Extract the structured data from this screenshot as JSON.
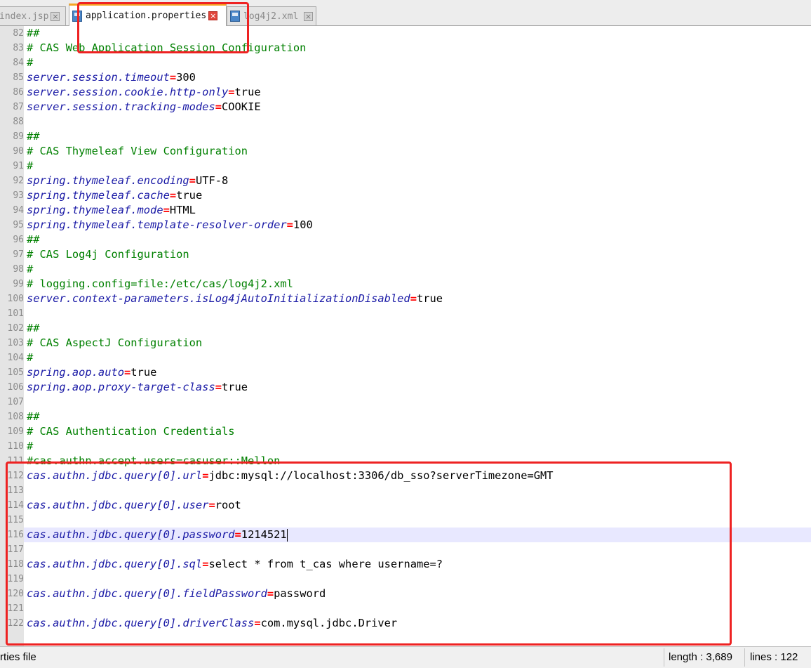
{
  "tabs": [
    {
      "label": "index.jsp",
      "active": false
    },
    {
      "label": "application.properties",
      "active": true
    },
    {
      "label": "log4j2.xml",
      "active": false
    }
  ],
  "lines": [
    {
      "num": "82",
      "type": "comment",
      "text": "##"
    },
    {
      "num": "83",
      "type": "comment",
      "text": "# CAS Web Application Session Configuration"
    },
    {
      "num": "84",
      "type": "comment",
      "text": "#"
    },
    {
      "num": "85",
      "type": "prop",
      "key": "server.session.timeout",
      "eq": "=",
      "value": "300"
    },
    {
      "num": "86",
      "type": "prop",
      "key": "server.session.cookie.http-only",
      "eq": "=",
      "value": "true"
    },
    {
      "num": "87",
      "type": "prop",
      "key": "server.session.tracking-modes",
      "eq": "=",
      "value": "COOKIE"
    },
    {
      "num": "88",
      "type": "blank"
    },
    {
      "num": "89",
      "type": "comment",
      "text": "##"
    },
    {
      "num": "90",
      "type": "comment",
      "text": "# CAS Thymeleaf View Configuration"
    },
    {
      "num": "91",
      "type": "comment",
      "text": "#"
    },
    {
      "num": "92",
      "type": "prop",
      "key": "spring.thymeleaf.encoding",
      "eq": "=",
      "value": "UTF-8"
    },
    {
      "num": "93",
      "type": "prop",
      "key": "spring.thymeleaf.cache",
      "eq": "=",
      "value": "true"
    },
    {
      "num": "94",
      "type": "prop",
      "key": "spring.thymeleaf.mode",
      "eq": "=",
      "value": "HTML"
    },
    {
      "num": "95",
      "type": "prop",
      "key": "spring.thymeleaf.template-resolver-order",
      "eq": "=",
      "value": "100"
    },
    {
      "num": "96",
      "type": "comment",
      "text": "##"
    },
    {
      "num": "97",
      "type": "comment",
      "text": "# CAS Log4j Configuration"
    },
    {
      "num": "98",
      "type": "comment",
      "text": "#"
    },
    {
      "num": "99",
      "type": "comment",
      "text": "# logging.config=file:/etc/cas/log4j2.xml"
    },
    {
      "num": "100",
      "type": "prop",
      "key": "server.context-parameters.isLog4jAutoInitializationDisabled",
      "eq": "=",
      "value": "true"
    },
    {
      "num": "101",
      "type": "blank"
    },
    {
      "num": "102",
      "type": "comment",
      "text": "##"
    },
    {
      "num": "103",
      "type": "comment",
      "text": "# CAS AspectJ Configuration"
    },
    {
      "num": "104",
      "type": "comment",
      "text": "#"
    },
    {
      "num": "105",
      "type": "prop",
      "key": "spring.aop.auto",
      "eq": "=",
      "value": "true"
    },
    {
      "num": "106",
      "type": "prop",
      "key": "spring.aop.proxy-target-class",
      "eq": "=",
      "value": "true"
    },
    {
      "num": "107",
      "type": "blank"
    },
    {
      "num": "108",
      "type": "comment",
      "text": "##"
    },
    {
      "num": "109",
      "type": "comment",
      "text": "# CAS Authentication Credentials"
    },
    {
      "num": "110",
      "type": "comment",
      "text": "#"
    },
    {
      "num": "111",
      "type": "comment",
      "text": "#cas.authn.accept.users=casuser::Mellon"
    },
    {
      "num": "112",
      "type": "prop",
      "key": "cas.authn.jdbc.query[0].url",
      "eq": "=",
      "value": "jdbc:mysql://localhost:3306/db_sso?serverTimezone=GMT"
    },
    {
      "num": "113",
      "type": "blank"
    },
    {
      "num": "114",
      "type": "prop",
      "key": "cas.authn.jdbc.query[0].user",
      "eq": "=",
      "value": "root"
    },
    {
      "num": "115",
      "type": "blank"
    },
    {
      "num": "116",
      "type": "prop",
      "key": "cas.authn.jdbc.query[0].password",
      "eq": "=",
      "value": "1214521",
      "current": true
    },
    {
      "num": "117",
      "type": "blank"
    },
    {
      "num": "118",
      "type": "prop",
      "key": "cas.authn.jdbc.query[0].sql",
      "eq": "=",
      "value": "select * from t_cas where username=?"
    },
    {
      "num": "119",
      "type": "blank"
    },
    {
      "num": "120",
      "type": "prop",
      "key": "cas.authn.jdbc.query[0].fieldPassword",
      "eq": "=",
      "value": "password"
    },
    {
      "num": "121",
      "type": "blank"
    },
    {
      "num": "122",
      "type": "prop",
      "key": "cas.authn.jdbc.query[0].driverClass",
      "eq": "=",
      "value": "com.mysql.jdbc.Driver"
    }
  ],
  "status": {
    "file_type": "Properties file",
    "length": "length : 3,689",
    "lines": "lines : 122"
  },
  "colors": {
    "key": "#1a1aa6",
    "comment": "#008000",
    "operator": "#ff0000",
    "annotation": "#ee2222",
    "current_line": "#e8e8ff"
  }
}
